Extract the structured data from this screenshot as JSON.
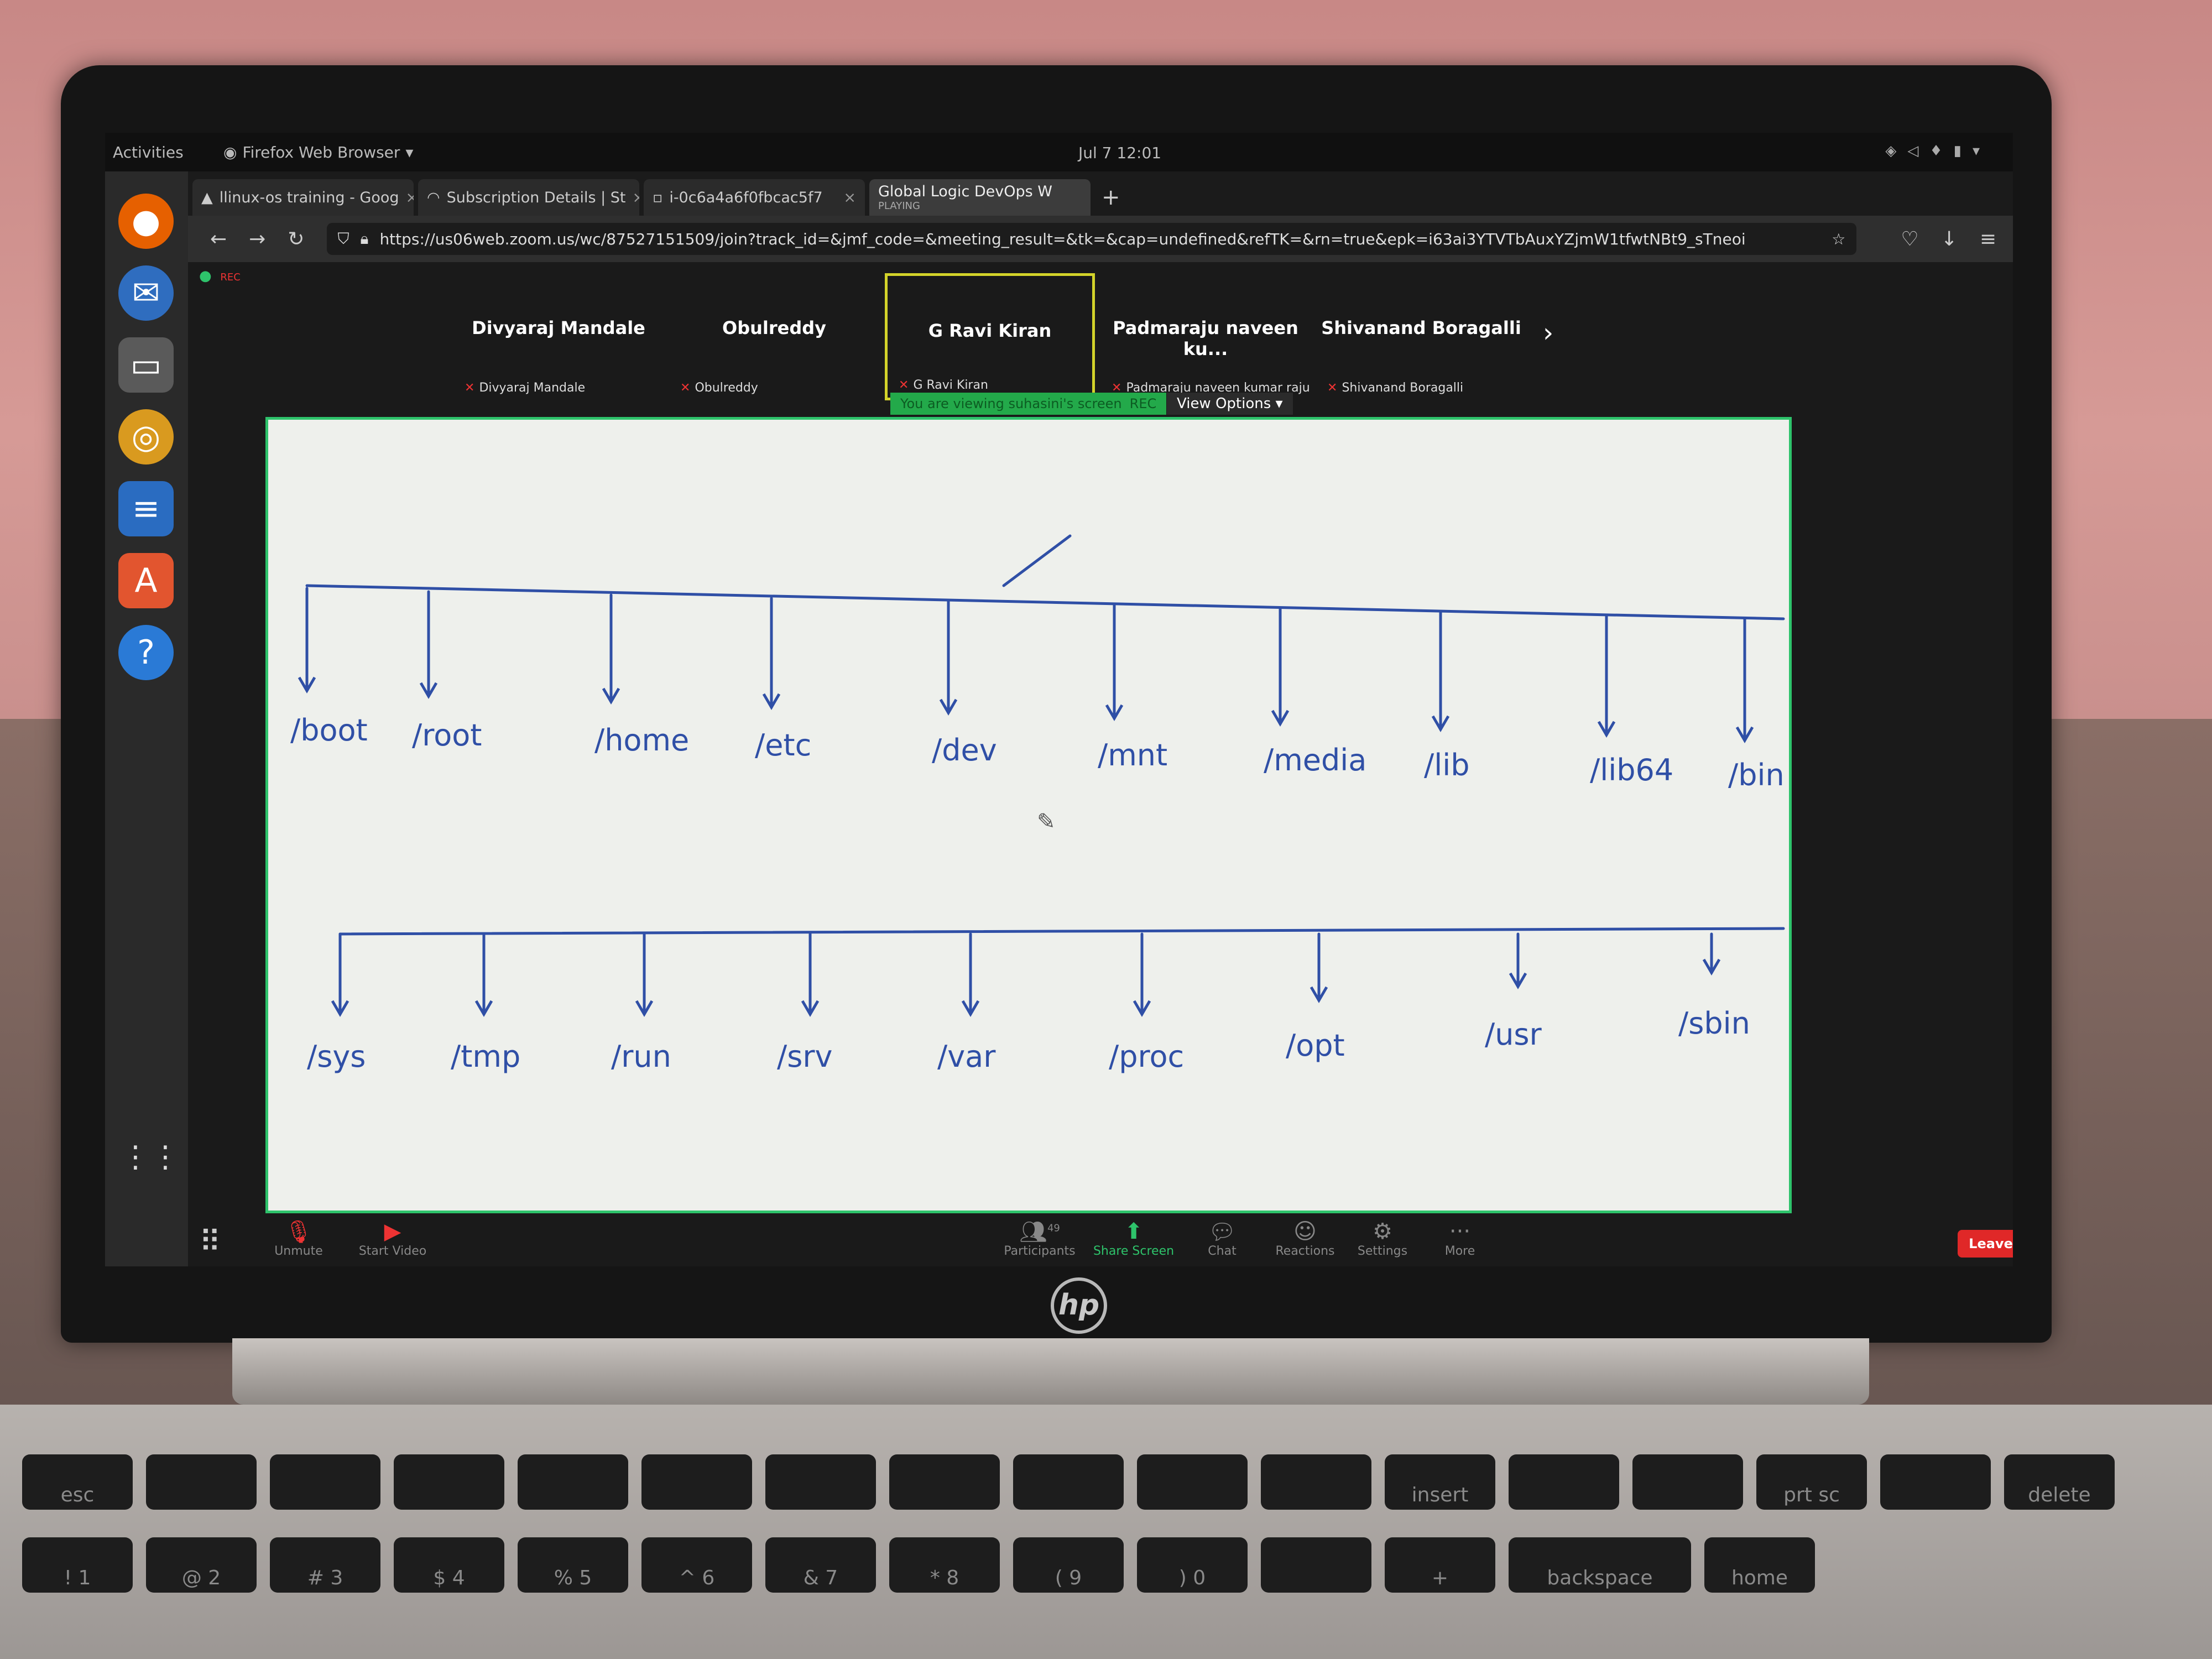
{
  "gnome": {
    "activities": "Activities",
    "app_name": "Firefox Web Browser",
    "clock": "Jul 7  12:01"
  },
  "dock": {
    "items": [
      "firefox-icon",
      "thunderbird-icon",
      "files-icon",
      "rhythmbox-icon",
      "libreoffice-writer-icon",
      "ubuntu-software-icon",
      "help-icon"
    ]
  },
  "browser": {
    "tabs": [
      {
        "label": "llinux-os training - Goog",
        "close": "×"
      },
      {
        "label": "Subscription Details | St",
        "close": "×"
      },
      {
        "label": "i-0c6a4a6f0fbcac5f7",
        "close": "×"
      },
      {
        "label": "Global Logic DevOps W",
        "sub": "PLAYING"
      }
    ],
    "new_tab": "+",
    "url": "https://us06web.zoom.us/wc/87527151509/join?track_id=&jmf_code=&meeting_result=&tk=&cap=undefined&refTK=&rn=true&epk=i63ai3YTVTbAuxYZjmW1tfwtNBt9_sTneoi"
  },
  "zoom": {
    "rec": "REC",
    "participants": [
      {
        "name": "Divyaraj Mandale",
        "label": "Divyaraj Mandale"
      },
      {
        "name": "Obulreddy",
        "label": "Obulreddy"
      },
      {
        "name": "G Ravi Kiran",
        "label": "G Ravi Kiran"
      },
      {
        "name": "Padmaraju naveen ku...",
        "label": "Padmaraju naveen kumar raju"
      },
      {
        "name": "Shivanand Boragalli",
        "label": "Shivanand Boragalli"
      }
    ],
    "viewing_banner": "You are viewing suhasini's screen",
    "view_options": "View Options",
    "toolbar": {
      "unmute": "Unmute",
      "start_video": "Start Video",
      "participants": "Participants",
      "participants_count": "49",
      "share_screen": "Share Screen",
      "chat": "Chat",
      "reactions": "Reactions",
      "settings": "Settings",
      "more": "More",
      "leave": "Leave"
    }
  },
  "whiteboard": {
    "row1": [
      "/boot",
      "/root",
      "/home",
      "/etc",
      "/dev",
      "/mnt",
      "/media",
      "/lib",
      "/lib64",
      "/bin"
    ],
    "row2": [
      "/sys",
      "/tmp",
      "/run",
      "/srv",
      "/var",
      "/proc",
      "/opt",
      "/usr",
      "/sbin"
    ],
    "ink_color": "#2f4fa6"
  },
  "keyboard": {
    "row1": [
      "esc",
      "",
      "",
      "",
      "",
      "",
      "",
      "",
      "",
      "",
      "",
      "insert",
      "",
      "",
      "prt sc",
      "",
      "delete"
    ],
    "row2": [
      "!\n1",
      "@\n2",
      "#\n3",
      "$\n4",
      "%\n5",
      "^\n6",
      "&\n7",
      "*\n8",
      "(\n9",
      ")\n0",
      "",
      "+",
      "backspace",
      "home"
    ]
  }
}
